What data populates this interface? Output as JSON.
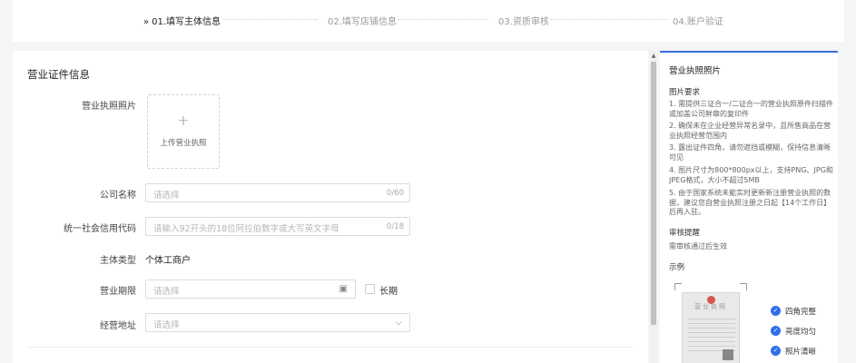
{
  "steps": [
    {
      "label": "01.填写主体信息",
      "active": true
    },
    {
      "label": "02.填写店铺信息",
      "active": false
    },
    {
      "label": "03.资质审核",
      "active": false
    },
    {
      "label": "04.账户验证",
      "active": false
    }
  ],
  "step_arrow": "»",
  "form": {
    "section_title": "营业证件信息",
    "license_photo_label": "营业执照照片",
    "upload_plus": "+",
    "upload_text": "上传营业执照",
    "company_name_label": "公司名称",
    "company_name_placeholder": "请选择",
    "company_name_count": "0/60",
    "credit_code_label": "统一社会信用代码",
    "credit_code_placeholder": "请输入92开头的18位阿拉伯数字或大写英文字母",
    "credit_code_count": "0/18",
    "entity_type_label": "主体类型",
    "entity_type_value": "个体工商户",
    "term_label": "营业期限",
    "term_placeholder": "请选择",
    "long_term_label": "长期",
    "address_label": "经营地址",
    "address_placeholder": "请选择"
  },
  "side": {
    "title": "营业执照照片",
    "req_title": "图片要求",
    "requirements": [
      "1. 需提供三证合一/二证合一的营业执照原件扫描件或加盖公司鲜章的复印件",
      "2. 确保未在企业经营异常名录中，且所售商品在营业执照经营范围内",
      "3. 露出证件四角，请勿遮挡或模糊，保持信息清晰可见",
      "4. 图片尺寸为800*800px以上，支持PNG、JPG和JPEG格式，大小不超过5MB",
      "5. 由于国家系统未能实时更新新注册营业执照的数据，建议您自营业执照注册之日起【14个工作日】后再入驻。"
    ],
    "review_title": "审核提醒",
    "review_text": "需审核通过后生效",
    "example_title": "示例",
    "sample_header": "营业执照",
    "checks": [
      "四角完整",
      "亮度均匀",
      "照片清晰"
    ]
  },
  "colors": {
    "accent": "#3a6fe0",
    "check": "#2f6fe8"
  }
}
